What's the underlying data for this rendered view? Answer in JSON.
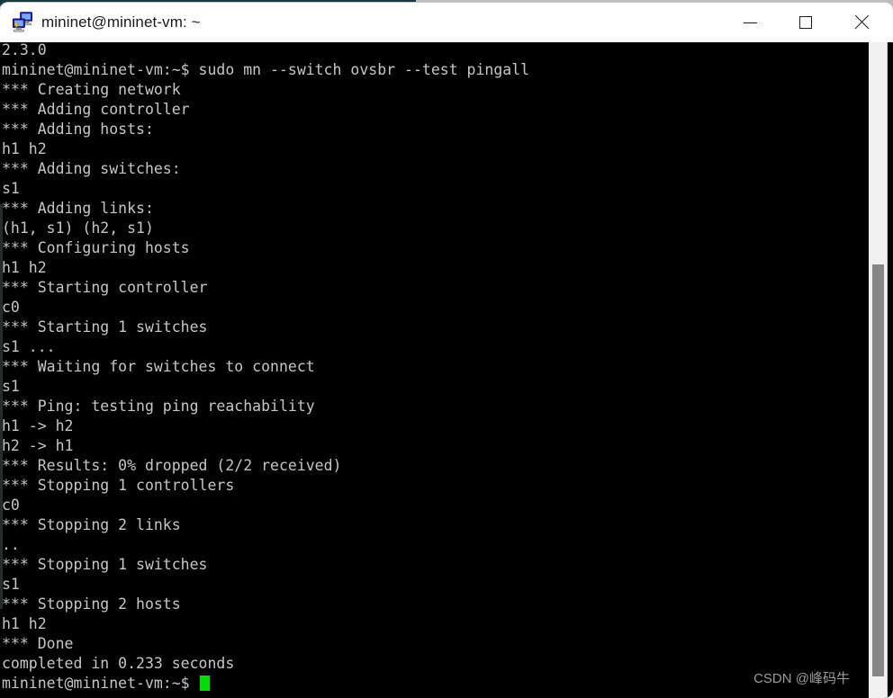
{
  "window": {
    "title": "mininet@mininet-vm: ~",
    "icon": "putty-terminal-icon",
    "controls": {
      "minimize_label": "Minimize",
      "maximize_label": "Maximize",
      "close_label": "Close"
    }
  },
  "terminal": {
    "background": "#000000",
    "foreground": "#c6c6c6",
    "cursor_color": "#00e000",
    "lines": [
      "2.3.0",
      "mininet@mininet-vm:~$ sudo mn --switch ovsbr --test pingall",
      "*** Creating network",
      "*** Adding controller",
      "*** Adding hosts:",
      "h1 h2",
      "*** Adding switches:",
      "s1",
      "*** Adding links:",
      "(h1, s1) (h2, s1)",
      "*** Configuring hosts",
      "h1 h2",
      "*** Starting controller",
      "c0",
      "*** Starting 1 switches",
      "s1 ...",
      "*** Waiting for switches to connect",
      "s1",
      "*** Ping: testing ping reachability",
      "h1 -> h2",
      "h2 -> h1",
      "*** Results: 0% dropped (2/2 received)",
      "*** Stopping 1 controllers",
      "c0",
      "*** Stopping 2 links",
      "..",
      "*** Stopping 1 switches",
      "s1",
      "*** Stopping 2 hosts",
      "h1 h2",
      "*** Done",
      "completed in 0.233 seconds"
    ],
    "prompt": "mininet@mininet-vm:~$ "
  },
  "scrollbar": {
    "orientation": "vertical",
    "thumb_color": "#868686",
    "track_color": "#f0f0f0"
  },
  "watermark": {
    "text": "CSDN @峰码牛"
  }
}
